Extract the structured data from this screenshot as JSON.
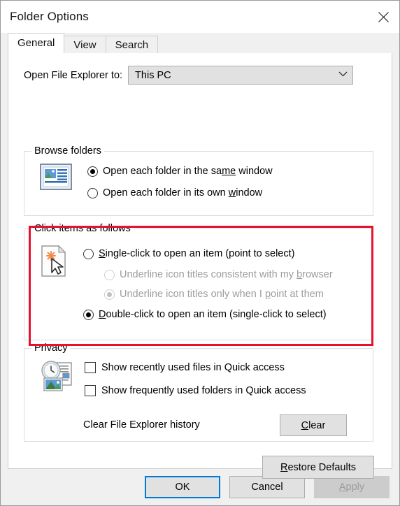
{
  "window": {
    "title": "Folder Options",
    "close_icon": "close-icon"
  },
  "tabs": [
    {
      "label": "General",
      "active": true
    },
    {
      "label": "View",
      "active": false
    },
    {
      "label": "Search",
      "active": false
    }
  ],
  "general": {
    "open_explorer_label": "Open File Explorer to:",
    "open_explorer_value": "This PC",
    "open_explorer_chevron": "chevron-down-icon",
    "browse_folders": {
      "title": "Browse folders",
      "icon": "folder-window-icon",
      "options": [
        {
          "pre": "Open each folder in the sa",
          "key": "me",
          "post": " window",
          "selected": true
        },
        {
          "pre": "Open each folder in its own ",
          "key": "w",
          "post": "indow",
          "selected": false
        }
      ]
    },
    "click_items": {
      "title": "Click items as follows",
      "icon": "pointer-click-icon",
      "highlighted": true,
      "highlight_color": "#e8112d",
      "options": [
        {
          "pre": "",
          "key": "S",
          "post": "ingle-click to open an item (point to select)",
          "selected": false,
          "disabled": false
        },
        {
          "pre": "Underline icon titles consistent with my ",
          "key": "b",
          "post": "rowser",
          "selected": false,
          "disabled": true,
          "sub": true
        },
        {
          "pre": "Underline icon titles only when I ",
          "key": "p",
          "post": "oint at them",
          "selected": true,
          "disabled": true,
          "sub": true
        },
        {
          "pre": "",
          "key": "D",
          "post": "ouble-click to open an item (single-click to select)",
          "selected": true,
          "disabled": false
        }
      ]
    },
    "privacy": {
      "title": "Privacy",
      "icon": "clock-history-icon",
      "checkboxes": [
        {
          "label": "Show recently used files in Quick access",
          "checked": false
        },
        {
          "label": "Show frequently used folders in Quick access",
          "checked": false
        }
      ],
      "clear_history_label": "Clear File Explorer history",
      "clear_button": {
        "pre": "",
        "key": "C",
        "post": "lear"
      }
    },
    "restore_defaults": {
      "pre": "",
      "key": "R",
      "post": "estore Defaults"
    }
  },
  "footer": {
    "ok": {
      "label": "OK",
      "default": true
    },
    "cancel": {
      "label": "Cancel"
    },
    "apply": {
      "pre": "",
      "key": "A",
      "post": "pply",
      "disabled": true
    }
  }
}
